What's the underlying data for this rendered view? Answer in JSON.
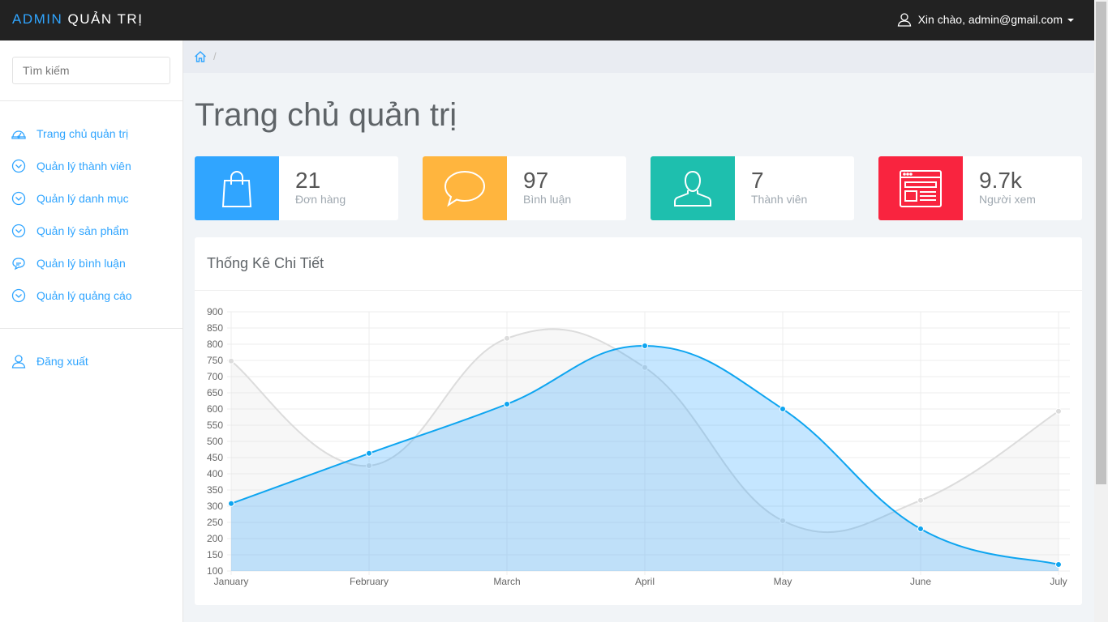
{
  "header": {
    "brand_accent": "ADMIN",
    "brand_rest": "QUẢN TRỊ",
    "greeting": "Xin chào, admin@gmail.com"
  },
  "sidebar": {
    "search_placeholder": "Tìm kiếm",
    "items": [
      {
        "label": "Trang chủ quản trị",
        "icon": "dashboard-icon"
      },
      {
        "label": "Quản lý thành viên",
        "icon": "chevron-circle-down-icon"
      },
      {
        "label": "Quản lý danh mục",
        "icon": "chevron-circle-down-icon"
      },
      {
        "label": "Quản lý sản phẩm",
        "icon": "chevron-circle-down-icon"
      },
      {
        "label": "Quản lý bình luận",
        "icon": "chat-icon"
      },
      {
        "label": "Quản lý quảng cáo",
        "icon": "chevron-circle-down-icon"
      }
    ],
    "logout_label": "Đăng xuất"
  },
  "breadcrumb": {
    "separator": "/"
  },
  "page": {
    "title": "Trang chủ quản trị"
  },
  "stats": [
    {
      "value": "21",
      "label": "Đơn hàng",
      "color": "#30a5ff",
      "icon": "shopping-bag-icon"
    },
    {
      "value": "97",
      "label": "Bình luận",
      "color": "#ffb53e",
      "icon": "speech-bubble-icon"
    },
    {
      "value": "7",
      "label": "Thành viên",
      "color": "#1ebfae",
      "icon": "user-icon"
    },
    {
      "value": "9.7k",
      "label": "Người xem",
      "color": "#f9243f",
      "icon": "browser-window-icon"
    }
  ],
  "panel": {
    "title": "Thống Kê Chi Tiết"
  },
  "colors": {
    "accent": "#30a5ff",
    "series_blue": "#0ea5f0",
    "series_gray": "#dcdcdc"
  },
  "chart_data": {
    "type": "area",
    "categories": [
      "January",
      "February",
      "March",
      "April",
      "May",
      "June",
      "July"
    ],
    "series": [
      {
        "values": [
          748,
          425,
          818,
          728,
          255,
          318,
          593
        ]
      },
      {
        "values": [
          308,
          463,
          615,
          795,
          600,
          230,
          120
        ]
      }
    ],
    "ylim": [
      100,
      900
    ],
    "yticks": [
      100,
      150,
      200,
      250,
      300,
      350,
      400,
      450,
      500,
      550,
      600,
      650,
      700,
      750,
      800,
      850,
      900
    ],
    "grid": true
  }
}
